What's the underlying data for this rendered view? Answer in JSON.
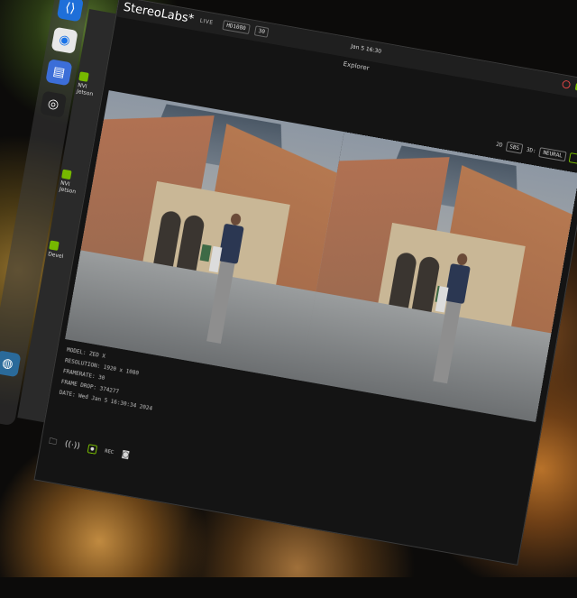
{
  "menubar": {
    "app_title": "StereoLabs*",
    "live_label": "LIVE",
    "resolution_select": "HD1080",
    "fps_select": "30",
    "clock": "Jan 5 16:30"
  },
  "window": {
    "title": "Explorer"
  },
  "controls": {
    "view_label": "2D",
    "view_select": "SBS",
    "depth_label": "3D:",
    "depth_select": "NEURAL"
  },
  "side_panel": {
    "items": [
      {
        "label": "NVI"
      },
      {
        "label": "Jetson"
      },
      {
        "label": "NVI"
      },
      {
        "label": "Jetson"
      },
      {
        "label": "Devel"
      }
    ]
  },
  "info": {
    "model": "MODEL: ZED X",
    "resolution": "RESOLUTION: 1920 x 1080",
    "framerate": "FRAMERATE: 30",
    "frame_drop": "FRAME DROP: 374277",
    "date": "DATE: Wed Jan 5 16:30:34 2024"
  },
  "toolbar": {
    "rec_label": "REC"
  },
  "colors": {
    "accent": "#76b900",
    "window_bg": "#141414"
  }
}
